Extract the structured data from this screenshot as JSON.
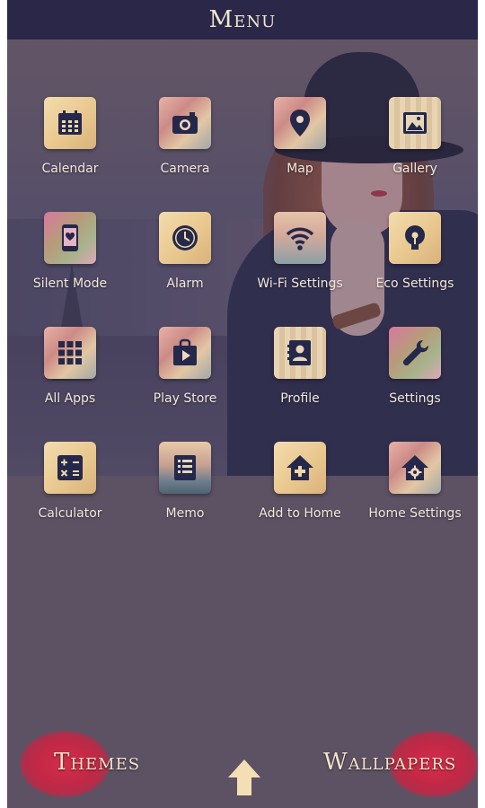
{
  "header": {
    "title": "Menu"
  },
  "apps": [
    {
      "label": "Calendar",
      "icon": "calendar-icon",
      "tile": "gold"
    },
    {
      "label": "Camera",
      "icon": "camera-icon",
      "tile": "photo-t"
    },
    {
      "label": "Map",
      "icon": "map-pin-icon",
      "tile": "photo-t"
    },
    {
      "label": "Gallery",
      "icon": "gallery-icon",
      "tile": "wood"
    },
    {
      "label": "Silent Mode",
      "icon": "silent-mode-icon",
      "tile": "floral"
    },
    {
      "label": "Alarm",
      "icon": "clock-icon",
      "tile": "gold"
    },
    {
      "label": "Wi-Fi Settings",
      "icon": "wifi-icon",
      "tile": "sky-t"
    },
    {
      "label": "Eco Settings",
      "icon": "eco-bulb-icon",
      "tile": "gold"
    },
    {
      "label": "All Apps",
      "icon": "grid-icon",
      "tile": "photo-t"
    },
    {
      "label": "Play Store",
      "icon": "shopping-bag-play-icon",
      "tile": "photo-t"
    },
    {
      "label": "Profile",
      "icon": "profile-card-icon",
      "tile": "wood"
    },
    {
      "label": "Settings",
      "icon": "wrench-icon",
      "tile": "floral"
    },
    {
      "label": "Calculator",
      "icon": "calculator-icon",
      "tile": "gold"
    },
    {
      "label": "Memo",
      "icon": "memo-list-icon",
      "tile": "city"
    },
    {
      "label": "Add to Home",
      "icon": "home-plus-icon",
      "tile": "gold"
    },
    {
      "label": "Home Settings",
      "icon": "home-gear-icon",
      "tile": "photo-t"
    }
  ],
  "footer": {
    "themes_label": "Themes",
    "wallpapers_label": "Wallpapers",
    "up_icon": "up-arrow-icon"
  },
  "colors": {
    "header_bg": "#2a2748",
    "accent_cream": "#f1e6cf",
    "kiss_red": "#c22845",
    "icon_navy": "#24284a"
  }
}
